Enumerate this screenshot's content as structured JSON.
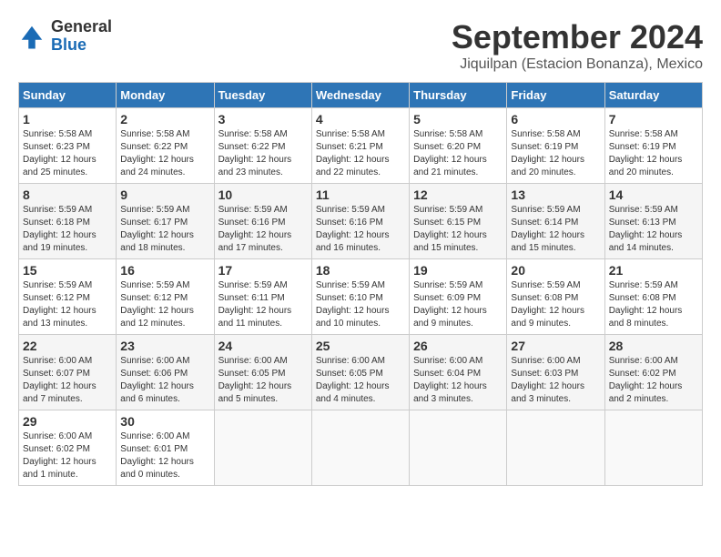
{
  "logo": {
    "general": "General",
    "blue": "Blue"
  },
  "title": "September 2024",
  "location": "Jiquilpan (Estacion Bonanza), Mexico",
  "headers": [
    "Sunday",
    "Monday",
    "Tuesday",
    "Wednesday",
    "Thursday",
    "Friday",
    "Saturday"
  ],
  "weeks": [
    [
      {
        "day": "1",
        "sunrise": "5:58 AM",
        "sunset": "6:23 PM",
        "daylight": "12 hours and 25 minutes."
      },
      {
        "day": "2",
        "sunrise": "5:58 AM",
        "sunset": "6:22 PM",
        "daylight": "12 hours and 24 minutes."
      },
      {
        "day": "3",
        "sunrise": "5:58 AM",
        "sunset": "6:22 PM",
        "daylight": "12 hours and 23 minutes."
      },
      {
        "day": "4",
        "sunrise": "5:58 AM",
        "sunset": "6:21 PM",
        "daylight": "12 hours and 22 minutes."
      },
      {
        "day": "5",
        "sunrise": "5:58 AM",
        "sunset": "6:20 PM",
        "daylight": "12 hours and 21 minutes."
      },
      {
        "day": "6",
        "sunrise": "5:58 AM",
        "sunset": "6:19 PM",
        "daylight": "12 hours and 20 minutes."
      },
      {
        "day": "7",
        "sunrise": "5:58 AM",
        "sunset": "6:19 PM",
        "daylight": "12 hours and 20 minutes."
      }
    ],
    [
      {
        "day": "8",
        "sunrise": "5:59 AM",
        "sunset": "6:18 PM",
        "daylight": "12 hours and 19 minutes."
      },
      {
        "day": "9",
        "sunrise": "5:59 AM",
        "sunset": "6:17 PM",
        "daylight": "12 hours and 18 minutes."
      },
      {
        "day": "10",
        "sunrise": "5:59 AM",
        "sunset": "6:16 PM",
        "daylight": "12 hours and 17 minutes."
      },
      {
        "day": "11",
        "sunrise": "5:59 AM",
        "sunset": "6:16 PM",
        "daylight": "12 hours and 16 minutes."
      },
      {
        "day": "12",
        "sunrise": "5:59 AM",
        "sunset": "6:15 PM",
        "daylight": "12 hours and 15 minutes."
      },
      {
        "day": "13",
        "sunrise": "5:59 AM",
        "sunset": "6:14 PM",
        "daylight": "12 hours and 15 minutes."
      },
      {
        "day": "14",
        "sunrise": "5:59 AM",
        "sunset": "6:13 PM",
        "daylight": "12 hours and 14 minutes."
      }
    ],
    [
      {
        "day": "15",
        "sunrise": "5:59 AM",
        "sunset": "6:12 PM",
        "daylight": "12 hours and 13 minutes."
      },
      {
        "day": "16",
        "sunrise": "5:59 AM",
        "sunset": "6:12 PM",
        "daylight": "12 hours and 12 minutes."
      },
      {
        "day": "17",
        "sunrise": "5:59 AM",
        "sunset": "6:11 PM",
        "daylight": "12 hours and 11 minutes."
      },
      {
        "day": "18",
        "sunrise": "5:59 AM",
        "sunset": "6:10 PM",
        "daylight": "12 hours and 10 minutes."
      },
      {
        "day": "19",
        "sunrise": "5:59 AM",
        "sunset": "6:09 PM",
        "daylight": "12 hours and 9 minutes."
      },
      {
        "day": "20",
        "sunrise": "5:59 AM",
        "sunset": "6:08 PM",
        "daylight": "12 hours and 9 minutes."
      },
      {
        "day": "21",
        "sunrise": "5:59 AM",
        "sunset": "6:08 PM",
        "daylight": "12 hours and 8 minutes."
      }
    ],
    [
      {
        "day": "22",
        "sunrise": "6:00 AM",
        "sunset": "6:07 PM",
        "daylight": "12 hours and 7 minutes."
      },
      {
        "day": "23",
        "sunrise": "6:00 AM",
        "sunset": "6:06 PM",
        "daylight": "12 hours and 6 minutes."
      },
      {
        "day": "24",
        "sunrise": "6:00 AM",
        "sunset": "6:05 PM",
        "daylight": "12 hours and 5 minutes."
      },
      {
        "day": "25",
        "sunrise": "6:00 AM",
        "sunset": "6:05 PM",
        "daylight": "12 hours and 4 minutes."
      },
      {
        "day": "26",
        "sunrise": "6:00 AM",
        "sunset": "6:04 PM",
        "daylight": "12 hours and 3 minutes."
      },
      {
        "day": "27",
        "sunrise": "6:00 AM",
        "sunset": "6:03 PM",
        "daylight": "12 hours and 3 minutes."
      },
      {
        "day": "28",
        "sunrise": "6:00 AM",
        "sunset": "6:02 PM",
        "daylight": "12 hours and 2 minutes."
      }
    ],
    [
      {
        "day": "29",
        "sunrise": "6:00 AM",
        "sunset": "6:02 PM",
        "daylight": "12 hours and 1 minute."
      },
      {
        "day": "30",
        "sunrise": "6:00 AM",
        "sunset": "6:01 PM",
        "daylight": "12 hours and 0 minutes."
      },
      null,
      null,
      null,
      null,
      null
    ]
  ],
  "labels": {
    "sunrise": "Sunrise:",
    "sunset": "Sunset:",
    "daylight": "Daylight:"
  }
}
